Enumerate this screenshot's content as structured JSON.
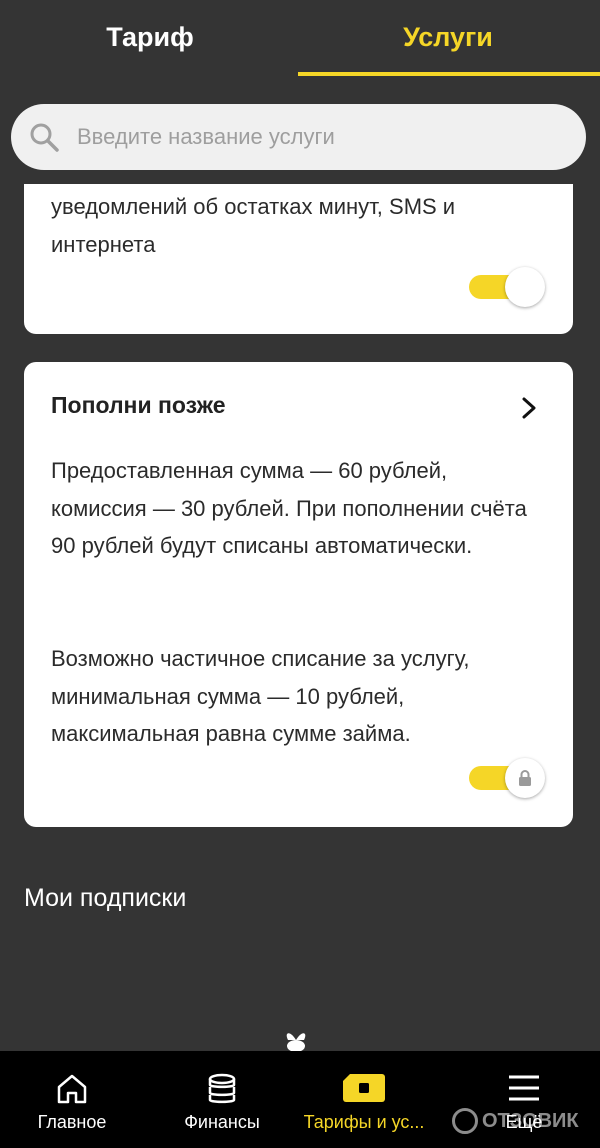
{
  "tabs": {
    "tariff": "Тариф",
    "services": "Услуги",
    "active": "services"
  },
  "search": {
    "placeholder": "Введите название услуги",
    "icon": "search-icon"
  },
  "cards": [
    {
      "text": "уведомлений об остатках минут, SMS и интернета",
      "toggle_on": true,
      "locked": false
    },
    {
      "title": "Пополни позже",
      "desc1": "Предоставленная сумма — 60 рублей, комиссия — 30 рублей. При пополнении счёта 90 рублей будут списаны автоматически.",
      "desc2": "Возможно частичное списание за услугу, минимальная сумма — 10 рублей, максимальная равна сумме займа.",
      "toggle_on": true,
      "locked": true
    }
  ],
  "subscriptions": {
    "title": "Мои подписки"
  },
  "bottom_nav": [
    {
      "label": "Главное",
      "icon": "home-icon"
    },
    {
      "label": "Финансы",
      "icon": "coins-icon"
    },
    {
      "label": "Тарифы и ус...",
      "icon": "sim-card-icon",
      "active": true
    },
    {
      "label": "Ещё",
      "icon": "menu-icon"
    }
  ],
  "watermark": "ОТЗОВИК",
  "colors": {
    "accent": "#f5d627",
    "background": "#343434",
    "card": "#ffffff",
    "nav": "#000000"
  }
}
